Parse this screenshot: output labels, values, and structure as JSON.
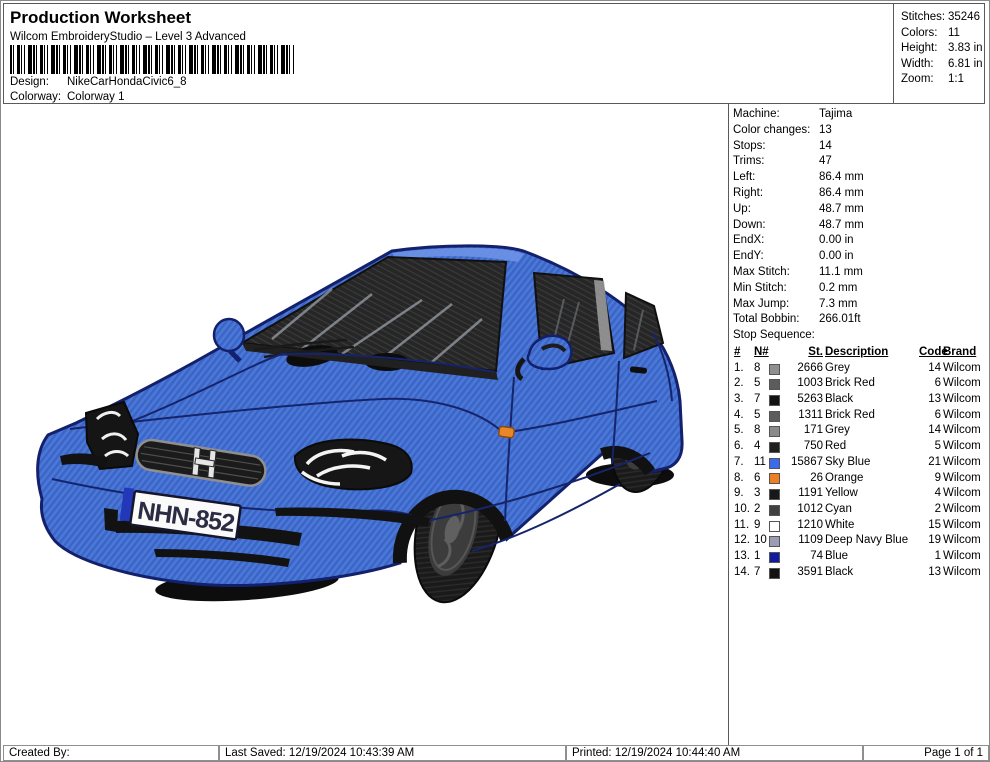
{
  "header": {
    "title": "Production Worksheet",
    "subtitle": "Wilcom EmbroideryStudio – Level 3 Advanced",
    "design": {
      "label": "Design:",
      "value": "NikeCarHondaCivic6_8"
    },
    "colorway": {
      "label": "Colorway:",
      "value": "Colorway 1"
    },
    "stats": [
      {
        "label": "Stitches:",
        "value": "35246"
      },
      {
        "label": "Colors:",
        "value": "11"
      },
      {
        "label": "Height:",
        "value": "3.83 in"
      },
      {
        "label": "Width:",
        "value": "6.81 in"
      },
      {
        "label": "Zoom:",
        "value": "1:1"
      }
    ]
  },
  "machine_info": [
    {
      "label": "Machine:",
      "value": "Tajima"
    },
    {
      "label": "Color changes:",
      "value": "13"
    },
    {
      "label": "Stops:",
      "value": "14"
    },
    {
      "label": "Trims:",
      "value": "47"
    },
    {
      "label": "Left:",
      "value": "86.4 mm"
    },
    {
      "label": "Right:",
      "value": "86.4 mm"
    },
    {
      "label": "Up:",
      "value": "48.7 mm"
    },
    {
      "label": "Down:",
      "value": "48.7 mm"
    },
    {
      "label": "EndX:",
      "value": "0.00 in"
    },
    {
      "label": "EndY:",
      "value": "0.00 in"
    },
    {
      "label": "Max Stitch:",
      "value": "11.1 mm"
    },
    {
      "label": "Min Stitch:",
      "value": "0.2 mm"
    },
    {
      "label": "Max Jump:",
      "value": "7.3 mm"
    },
    {
      "label": "Total Bobbin:",
      "value": "266.01ft"
    }
  ],
  "stop_sequence": {
    "title": "Stop Sequence:",
    "columns": {
      "num": "#",
      "needle": "N#",
      "stitches": "St.",
      "description": "Description",
      "code": "Code",
      "brand": "Brand"
    },
    "rows": [
      {
        "num": "1.",
        "needle": "8",
        "color": "#8f8f8f",
        "st": "2666",
        "description": "Grey",
        "code": "14",
        "brand": "Wilcom"
      },
      {
        "num": "2.",
        "needle": "5",
        "color": "#5c5c5c",
        "st": "1003",
        "description": "Brick Red",
        "code": "6",
        "brand": "Wilcom"
      },
      {
        "num": "3.",
        "needle": "7",
        "color": "#121212",
        "st": "5263",
        "description": "Black",
        "code": "13",
        "brand": "Wilcom"
      },
      {
        "num": "4.",
        "needle": "5",
        "color": "#5c5c5c",
        "st": "1311",
        "description": "Brick Red",
        "code": "6",
        "brand": "Wilcom"
      },
      {
        "num": "5.",
        "needle": "8",
        "color": "#8a8a8a",
        "st": "171",
        "description": "Grey",
        "code": "14",
        "brand": "Wilcom"
      },
      {
        "num": "6.",
        "needle": "4",
        "color": "#1f1f1f",
        "st": "750",
        "description": "Red",
        "code": "5",
        "brand": "Wilcom"
      },
      {
        "num": "7.",
        "needle": "11",
        "color": "#3b6af0",
        "st": "15867",
        "description": "Sky Blue",
        "code": "21",
        "brand": "Wilcom"
      },
      {
        "num": "8.",
        "needle": "6",
        "color": "#ee7f22",
        "st": "26",
        "description": "Orange",
        "code": "9",
        "brand": "Wilcom"
      },
      {
        "num": "9.",
        "needle": "3",
        "color": "#181818",
        "st": "1191",
        "description": "Yellow",
        "code": "4",
        "brand": "Wilcom"
      },
      {
        "num": "10.",
        "needle": "2",
        "color": "#404040",
        "st": "1012",
        "description": "Cyan",
        "code": "2",
        "brand": "Wilcom"
      },
      {
        "num": "11.",
        "needle": "9",
        "color": "#ffffff",
        "st": "1210",
        "description": "White",
        "code": "15",
        "brand": "Wilcom"
      },
      {
        "num": "12.",
        "needle": "10",
        "color": "#9c9cb4",
        "st": "1109",
        "description": "Deep Navy Blue",
        "code": "19",
        "brand": "Wilcom"
      },
      {
        "num": "13.",
        "needle": "1",
        "color": "#121ba0",
        "st": "74",
        "description": "Blue",
        "code": "1",
        "brand": "Wilcom"
      },
      {
        "num": "14.",
        "needle": "7",
        "color": "#121212",
        "st": "3591",
        "description": "Black",
        "code": "13",
        "brand": "Wilcom"
      }
    ]
  },
  "design_preview": {
    "license_plate": "NHN-852",
    "body_color": "#4471d3",
    "outline_color": "#13206b",
    "window_color": "#252525",
    "marker_color": "#e8872a"
  },
  "footer": {
    "created_by": "Created By:",
    "last_saved": "Last Saved: 12/19/2024 10:43:39 AM",
    "printed": "Printed: 12/19/2024 10:44:40 AM",
    "page": "Page 1 of 1"
  }
}
